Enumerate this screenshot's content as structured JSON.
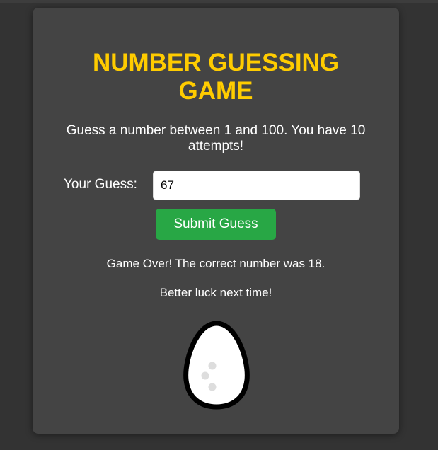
{
  "game": {
    "title_line1": "NUMBER GUESSING",
    "title_line2": "GAME",
    "instructions": "Guess a number between 1 and 100. You have 10 attempts!",
    "guess_label": "Your Guess:",
    "guess_value": "67",
    "submit_label": "Submit Guess",
    "result_message": "Game Over! The correct number was 18.",
    "status_message": "Better luck next time!"
  },
  "colors": {
    "background": "#333333",
    "card": "#444444",
    "title": "#ffcc00",
    "button": "#28a745",
    "text": "#ffffff"
  },
  "icons": {
    "egg": "egg-icon"
  }
}
